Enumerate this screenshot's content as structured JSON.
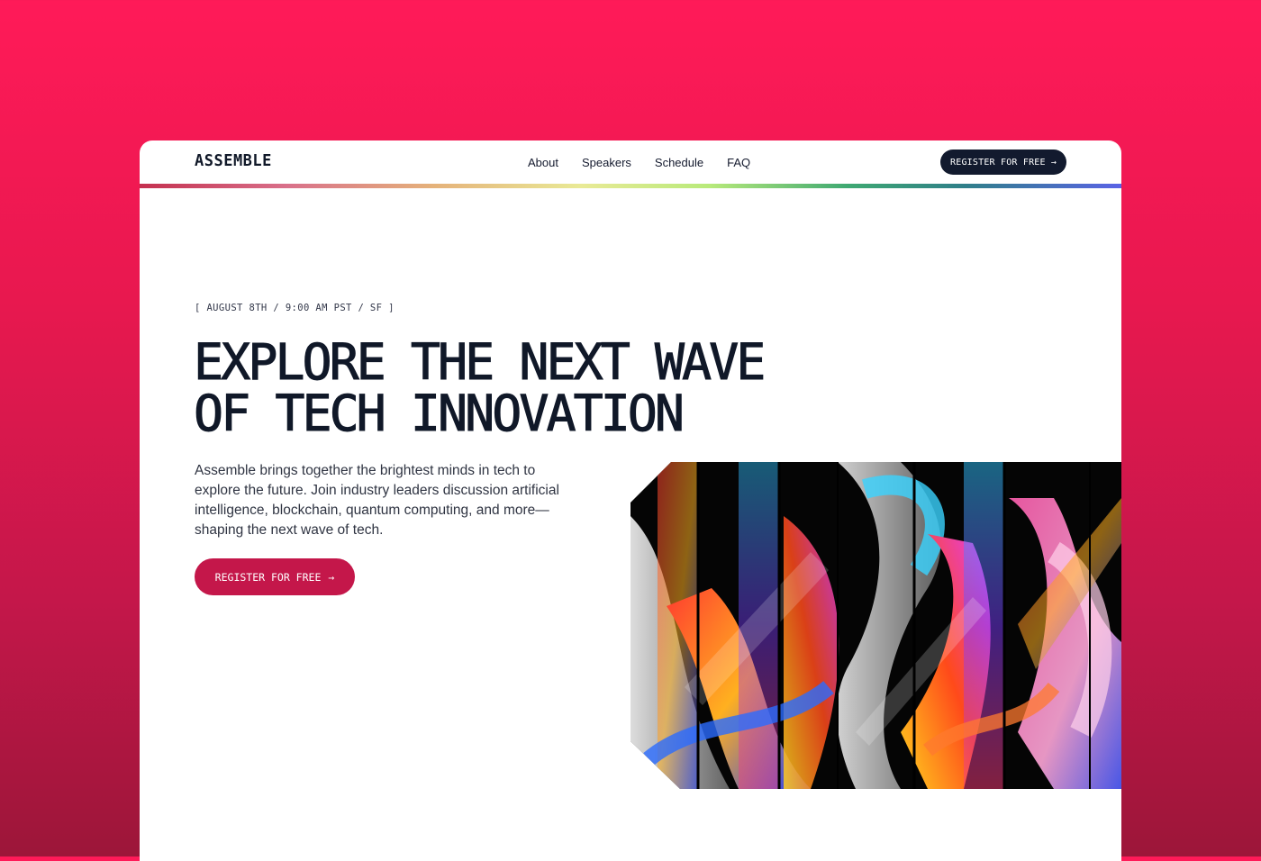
{
  "nav": {
    "logo": "ASSEMBLE",
    "links": [
      "About",
      "Speakers",
      "Schedule",
      "FAQ"
    ],
    "register_label": "REGISTER FOR FREE",
    "register_icon": "arrow-right-icon"
  },
  "hero": {
    "dateline": "[ AUGUST 8TH / 9:00 AM PST / SF ]",
    "headline_line1": "EXPLORE THE NEXT WAVE",
    "headline_line2": "OF TECH INNOVATION",
    "lead": "Assemble brings together the brightest minds in tech to explore the future. Join industry leaders discussion artificial intelligence, blockchain, quantum computing, and more—shaping the next wave of tech.",
    "cta_label": "REGISTER FOR FREE",
    "cta_icon": "arrow-right-icon"
  },
  "colors": {
    "background_top": "#ff1a58",
    "background_bottom": "#9c1639",
    "nav_button": "#121a2e",
    "cta": "#c4174a",
    "text_dark": "#101828"
  }
}
